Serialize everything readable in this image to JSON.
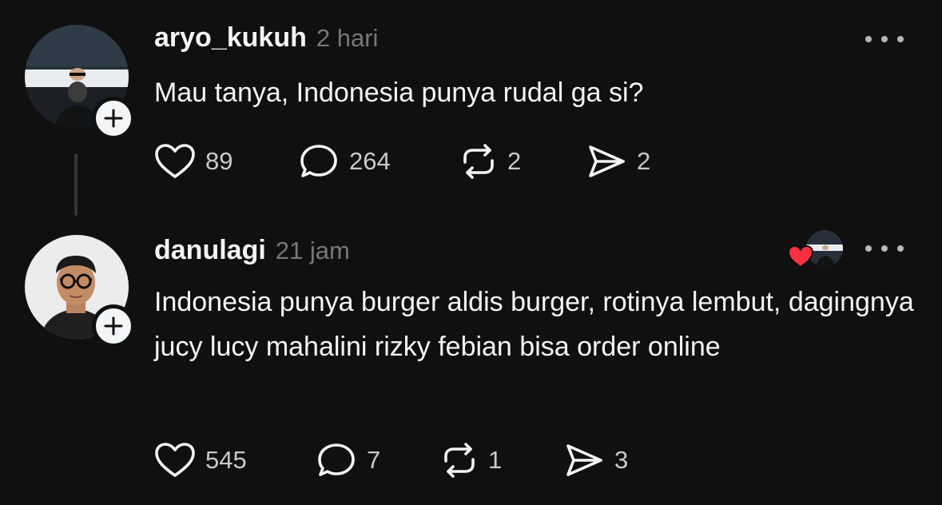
{
  "posts": [
    {
      "username": "aryo_kukuh",
      "time": "2 hari",
      "content": "Mau tanya, Indonesia punya rudal ga si?",
      "likes": "89",
      "replies": "264",
      "reposts": "2",
      "shares": "2"
    },
    {
      "username": "danulagi",
      "time": "21 jam",
      "content": "Indonesia punya burger aldis burger, rotinya lembut, dagingnya jucy lucy mahalini rizky febian bisa order online",
      "likes": "545",
      "replies": "7",
      "reposts": "1",
      "shares": "3"
    }
  ],
  "icons": {
    "follow": "plus-icon",
    "more": "more-dots-icon",
    "like": "heart-icon",
    "reply": "comment-icon",
    "repost": "repost-icon",
    "share": "send-icon",
    "liked_by_author": "red-heart-icon"
  },
  "colors": {
    "background": "#101010",
    "text": "#f3f5f7",
    "muted": "#777777",
    "heart_red": "#ff3040"
  }
}
